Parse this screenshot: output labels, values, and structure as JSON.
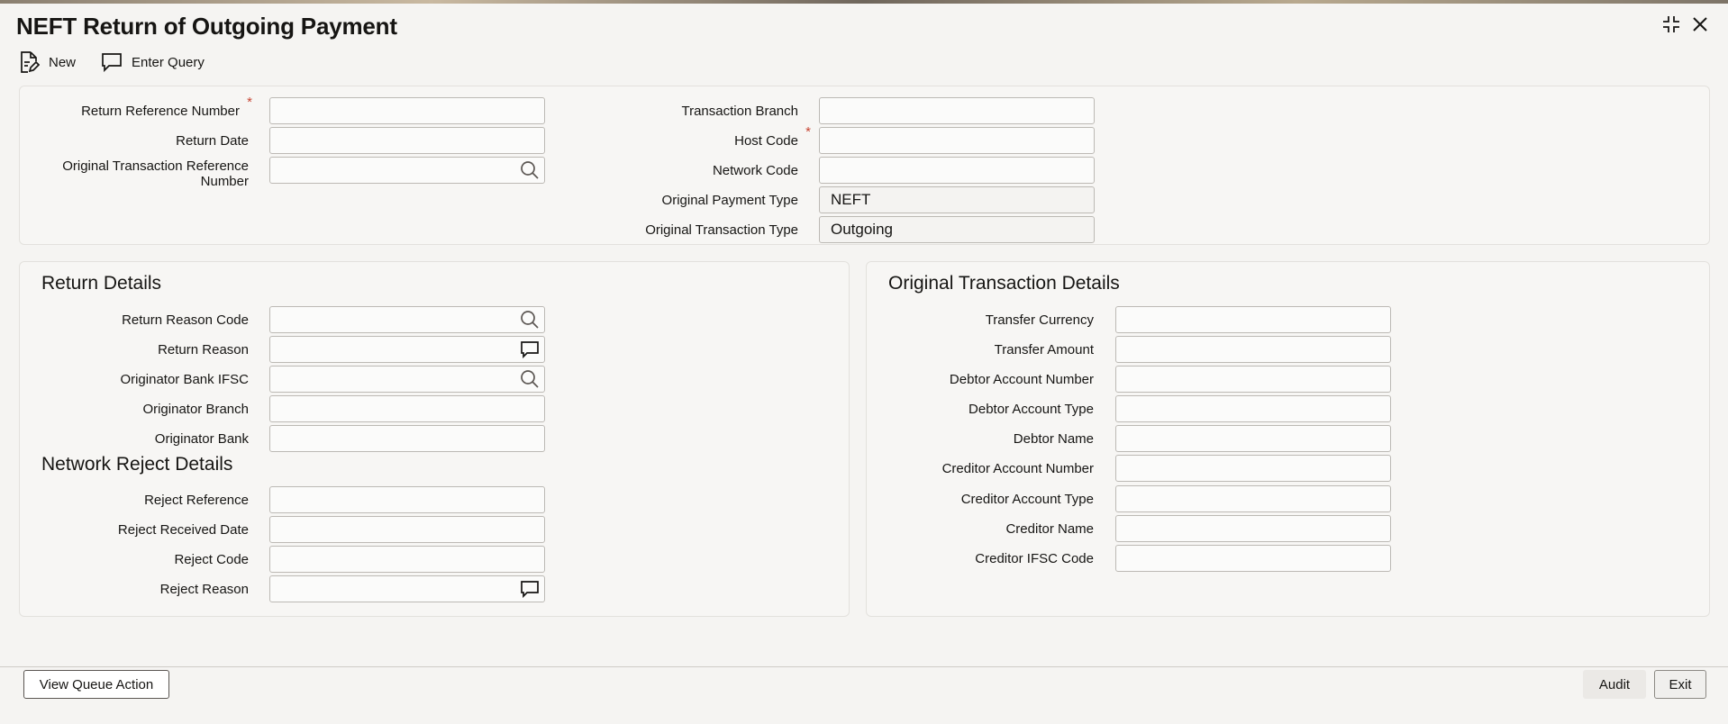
{
  "window": {
    "title": "NEFT Return of Outgoing Payment"
  },
  "toolbar": {
    "new_label": "New",
    "enter_query_label": "Enter Query"
  },
  "header": {
    "return_reference_number": {
      "label": "Return Reference Number",
      "value": ""
    },
    "return_date": {
      "label": "Return Date",
      "value": ""
    },
    "original_transaction_reference_number": {
      "label_line1": "Original Transaction Reference",
      "label_line2": "Number",
      "value": ""
    },
    "transaction_branch": {
      "label": "Transaction Branch",
      "value": ""
    },
    "host_code": {
      "label": "Host Code",
      "value": ""
    },
    "network_code": {
      "label": "Network Code",
      "value": ""
    },
    "original_payment_type": {
      "label": "Original Payment Type",
      "value": "NEFT"
    },
    "original_transaction_type": {
      "label": "Original Transaction Type",
      "value": "Outgoing"
    },
    "required_mark": "*"
  },
  "return_details": {
    "title": "Return Details",
    "return_reason_code": {
      "label": "Return Reason Code",
      "value": ""
    },
    "return_reason": {
      "label": "Return Reason",
      "value": ""
    },
    "originator_bank_ifsc": {
      "label": "Originator Bank IFSC",
      "value": ""
    },
    "originator_branch": {
      "label": "Originator Branch",
      "value": ""
    },
    "originator_bank": {
      "label": "Originator Bank",
      "value": ""
    }
  },
  "network_reject_details": {
    "title": "Network Reject Details",
    "reject_reference": {
      "label": "Reject Reference",
      "value": ""
    },
    "reject_received_date": {
      "label": "Reject Received Date",
      "value": ""
    },
    "reject_code": {
      "label": "Reject Code",
      "value": ""
    },
    "reject_reason": {
      "label": "Reject Reason",
      "value": ""
    }
  },
  "original_transaction_details": {
    "title": "Original Transaction Details",
    "transfer_currency": {
      "label": "Transfer Currency",
      "value": ""
    },
    "transfer_amount": {
      "label": "Transfer Amount",
      "value": ""
    },
    "debtor_account_number": {
      "label": "Debtor Account Number",
      "value": ""
    },
    "debtor_account_type": {
      "label": "Debtor Account Type",
      "value": ""
    },
    "debtor_name": {
      "label": "Debtor Name",
      "value": ""
    },
    "creditor_account_number": {
      "label": "Creditor Account Number",
      "value": ""
    },
    "creditor_account_type": {
      "label": "Creditor Account Type",
      "value": ""
    },
    "creditor_name": {
      "label": "Creditor Name",
      "value": ""
    },
    "creditor_ifsc_code": {
      "label": "Creditor IFSC Code",
      "value": ""
    }
  },
  "footer": {
    "view_queue_action_label": "View Queue Action",
    "audit_label": "Audit",
    "exit_label": "Exit"
  },
  "icons": {
    "new": "new-document-icon",
    "enter_query": "chat-bubble-icon",
    "search": "search-icon",
    "comment": "comment-icon",
    "minimize": "collapse-icon",
    "close": "close-icon"
  },
  "colors": {
    "required": "#c74634",
    "text": "#161513",
    "background": "#f5f4f2"
  }
}
